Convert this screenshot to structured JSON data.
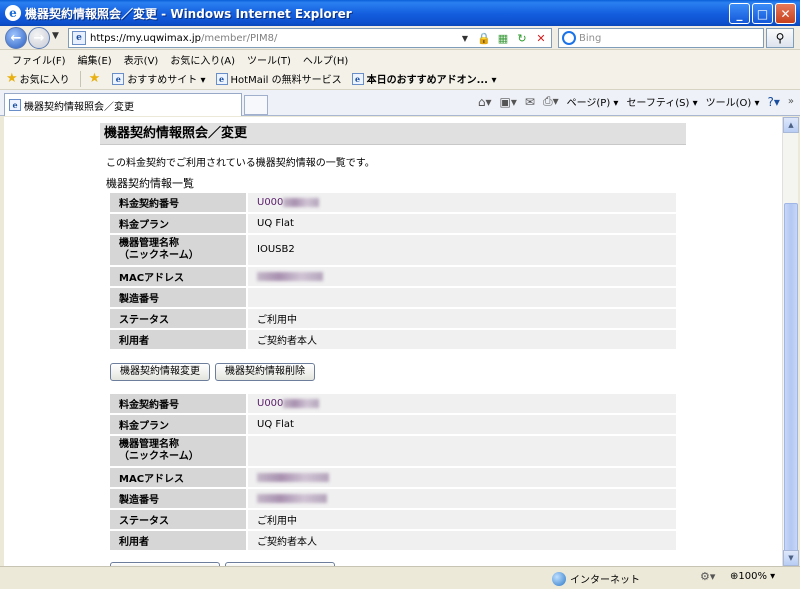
{
  "window": {
    "title": "機器契約情報照会／変更 - Windows Internet Explorer"
  },
  "address": {
    "url_prefix": "https://",
    "url_host": "my.uqwimax.jp",
    "url_path": "/member/PIM8/",
    "search_placeholder": "Bing"
  },
  "menu": [
    "ファイル(F)",
    "編集(E)",
    "表示(V)",
    "お気に入り(A)",
    "ツール(T)",
    "ヘルプ(H)"
  ],
  "favorites": {
    "favorites_label": "お気に入り",
    "items": [
      "おすすめサイト ▾",
      "HotMail の無料サービス",
      "本日のおすすめアドオン... ▾"
    ]
  },
  "tab": {
    "label": "機器契約情報照会／変更"
  },
  "commands": {
    "page": "ページ(P) ▾",
    "safety": "セーフティ(S) ▾",
    "tools": "ツール(O) ▾"
  },
  "page": {
    "title": "機器契約情報照会／変更",
    "description": "この料金契約でご利用されている機器契約情報の一覧です。",
    "subheading": "機器契約情報一覧",
    "contract1": {
      "rows": [
        {
          "label": "料金契約番号",
          "value": "U000"
        },
        {
          "label": "料金プラン",
          "value": "UQ Flat"
        },
        {
          "label": "機器管理名称\n（ニックネーム）",
          "value": "IOUSB2"
        },
        {
          "label": "MACアドレス",
          "value": ""
        },
        {
          "label": "製造番号",
          "value": ""
        },
        {
          "label": "ステータス",
          "value": "ご利用中"
        },
        {
          "label": "利用者",
          "value": "ご契約者本人"
        }
      ],
      "change_button": "機器契約情報変更",
      "delete_button": "機器契約情報削除"
    },
    "contract2": {
      "rows": [
        {
          "label": "料金契約番号",
          "value": "U000"
        },
        {
          "label": "料金プラン",
          "value": "UQ Flat"
        },
        {
          "label": "機器管理名称\n（ニックネーム）",
          "value": ""
        },
        {
          "label": "MACアドレス",
          "value": ""
        },
        {
          "label": "製造番号",
          "value": ""
        },
        {
          "label": "ステータス",
          "value": "ご利用中"
        },
        {
          "label": "利用者",
          "value": "ご契約者本人"
        }
      ]
    }
  },
  "status": {
    "zone": "インターネット",
    "zoom": "100%"
  }
}
